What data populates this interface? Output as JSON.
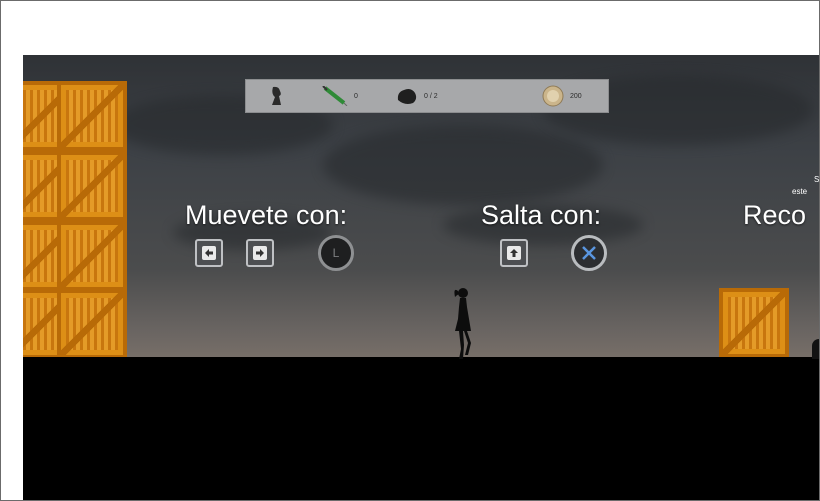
{
  "hud": {
    "syringe_count": "0",
    "rock_count": "0 / 2",
    "coin_count": "200"
  },
  "tutorial": {
    "move_label": "Muevete con:",
    "jump_label": "Salta con:",
    "collect_label": "Reco",
    "collect_small_top": "S",
    "collect_small_bottom": "este"
  },
  "controls": {
    "stick_letter": "L"
  },
  "colors": {
    "crate": "#dd8f16",
    "hud_bg": "#a7a8aa",
    "ground": "#000000"
  }
}
